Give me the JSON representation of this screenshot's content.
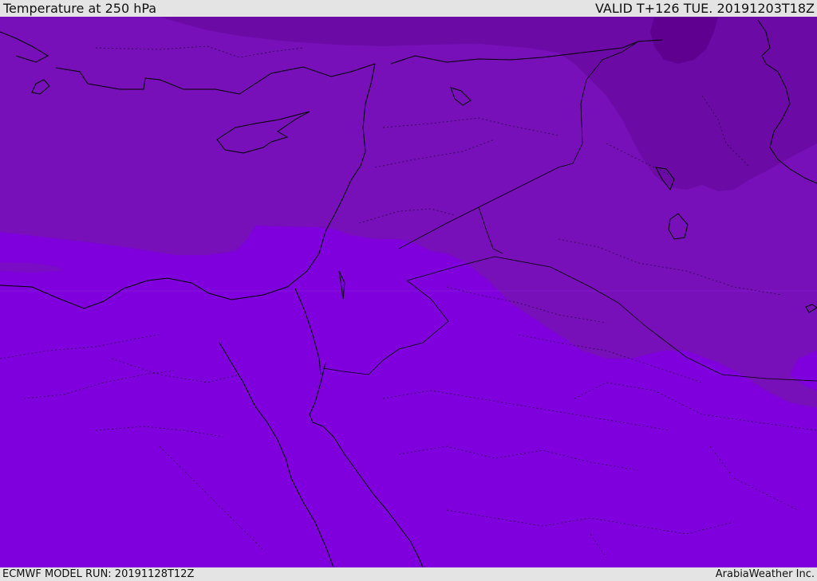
{
  "header": {
    "title": "Temperature at 250 hPa",
    "valid_time": "VALID T+126 TUE. 20191203T18Z"
  },
  "footer": {
    "model_run": "ECMWF MODEL RUN: 20191128T12Z",
    "credit": "ArabiaWeather Inc."
  },
  "map": {
    "colors": {
      "zone_warmest": "#7f00dc",
      "zone_mid": "#7710b8",
      "zone_cold": "#6c0aa6",
      "zone_coldest": "#600090",
      "coastline": "#000000"
    }
  }
}
